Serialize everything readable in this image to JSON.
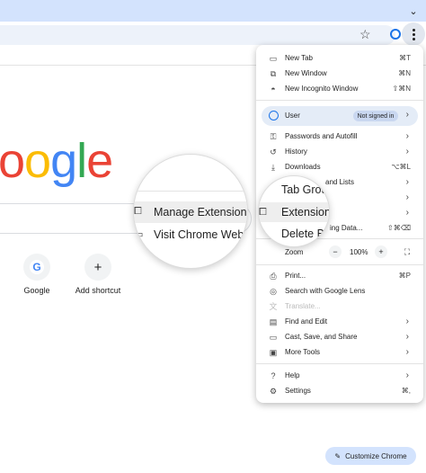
{
  "logo_text": "oogle",
  "shortcuts": [
    {
      "label": "Google",
      "icon": "google-g-icon",
      "glyph": "G"
    },
    {
      "label": "Add shortcut",
      "icon": "plus-icon",
      "glyph": "+"
    }
  ],
  "customize_label": "Customize Chrome",
  "menu": {
    "new_tab": {
      "label": "New Tab",
      "shortcut": "⌘T"
    },
    "new_window": {
      "label": "New Window",
      "shortcut": "⌘N"
    },
    "incognito": {
      "label": "New Incognito Window",
      "shortcut": "⇧⌘N"
    },
    "user": {
      "label": "User",
      "status": "Not signed in"
    },
    "passwords": {
      "label": "Passwords and Autofill"
    },
    "history": {
      "label": "History"
    },
    "downloads": {
      "label": "Downloads",
      "shortcut": "⌥⌘L"
    },
    "bookmarks": {
      "label": "and Lists"
    },
    "clear": {
      "label": "ing Data...",
      "shortcut": "⇧⌘⌫"
    },
    "zoom": {
      "label": "Zoom",
      "value": "100%",
      "minus": "−",
      "plus": "+"
    },
    "print": {
      "label": "Print...",
      "shortcut": "⌘P"
    },
    "lens": {
      "label": "Search with Google Lens"
    },
    "translate": {
      "label": "Translate..."
    },
    "find": {
      "label": "Find and Edit"
    },
    "cast": {
      "label": "Cast, Save, and Share"
    },
    "more_tools": {
      "label": "More Tools"
    },
    "help": {
      "label": "Help"
    },
    "settings": {
      "label": "Settings",
      "shortcut": "⌘,"
    }
  },
  "magnifier_left": {
    "manage_ext": "Manage Extensions",
    "visit_store": "Visit Chrome Web S"
  },
  "magnifier_right": {
    "tab_groups": "Tab Grou",
    "extensions": "Extensions",
    "delete": "Delete Br"
  },
  "colors": {
    "accent": "#1a73e8",
    "tabstrip": "#d3e3fd"
  }
}
